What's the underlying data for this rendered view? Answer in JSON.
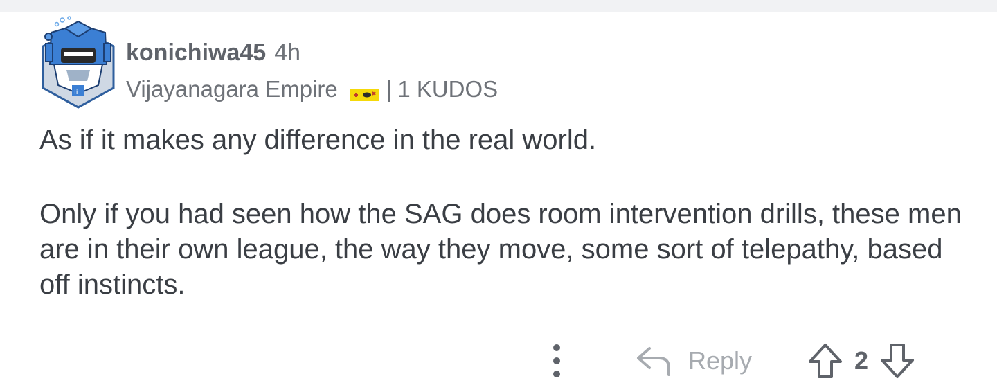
{
  "comment": {
    "author": "konichiwa45",
    "time": "4h",
    "flair": "Vijayanagara Empire",
    "separator": "|",
    "kudos": "1 KUDOS",
    "paragraphs": [
      "As if it makes any difference in the real world.",
      "Only if you had seen how the SAG does room intervention drills, these men are in their own league, the way they move, some sort of telepathy, based off instincts."
    ]
  },
  "actions": {
    "reply_label": "Reply",
    "vote_count": "2",
    "icons": [
      "more-vertical-icon",
      "reply-arrow-icon",
      "upvote-arrow-icon",
      "downvote-arrow-icon"
    ]
  },
  "colors": {
    "page_background": "#ffffff",
    "top_strip": "#f1f2f4",
    "body_text": "#3a3e44",
    "meta_text": "#6e7278",
    "muted_icon": "#a7abb0",
    "avatar_blue": "#3b7fd4",
    "flair_yellow": "#f5d90a"
  }
}
